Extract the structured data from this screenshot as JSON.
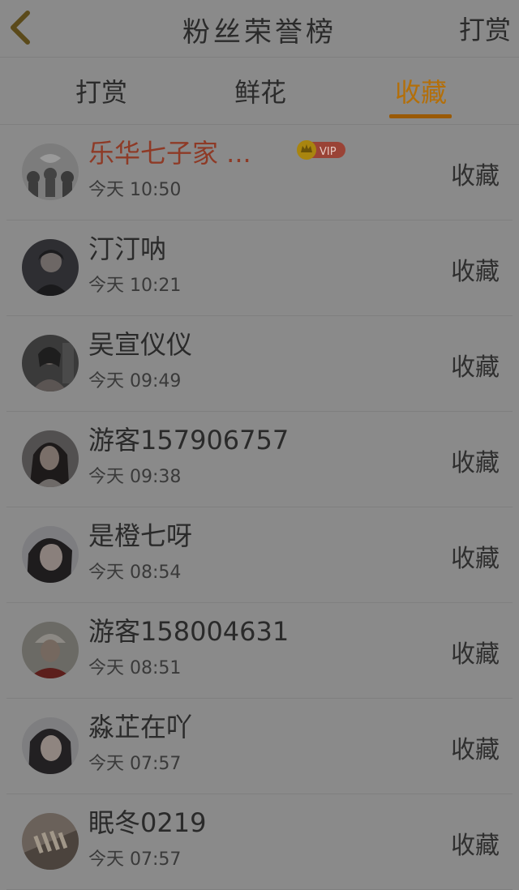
{
  "header": {
    "title": "粉丝荣誉榜",
    "action_label": "打赏"
  },
  "tabs": [
    {
      "label": "打赏",
      "active": false
    },
    {
      "label": "鲜花",
      "active": false
    },
    {
      "label": "收藏",
      "active": true
    }
  ],
  "colors": {
    "accent": "#b36f0a",
    "highlight_name": "#8e3a26",
    "vip_badge": "#9a4336",
    "crown": "#a9850f"
  },
  "vip_label": "VIP",
  "fans": [
    {
      "name": "乐华七子家 ...",
      "time": "今天 10:50",
      "action": "收藏",
      "vip": true
    },
    {
      "name": "汀汀呐",
      "time": "今天 10:21",
      "action": "收藏",
      "vip": false
    },
    {
      "name": "吴宣仪仪",
      "time": "今天 09:49",
      "action": "收藏",
      "vip": false
    },
    {
      "name": "游客157906757 ...",
      "time": "今天 09:38",
      "action": "收藏",
      "vip": false
    },
    {
      "name": "是橙七呀",
      "time": "今天 08:54",
      "action": "收藏",
      "vip": false
    },
    {
      "name": "游客158004631 ...",
      "time": "今天 08:51",
      "action": "收藏",
      "vip": false
    },
    {
      "name": "淼芷在吖",
      "time": "今天 07:57",
      "action": "收藏",
      "vip": false
    },
    {
      "name": "眠冬0219",
      "time": "今天 07:57",
      "action": "收藏",
      "vip": false
    }
  ]
}
